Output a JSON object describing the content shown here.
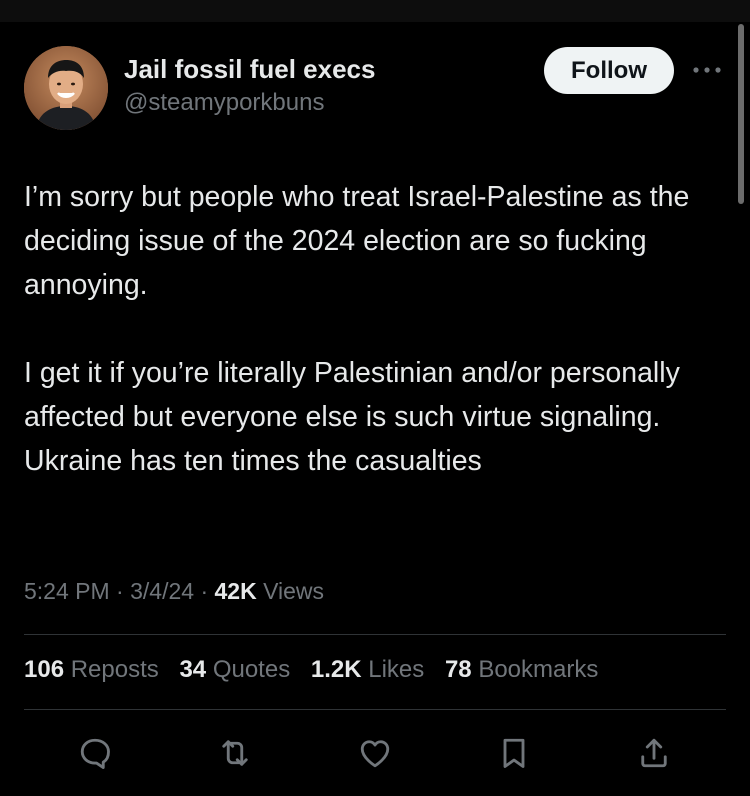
{
  "author": {
    "display_name": "Jail fossil fuel execs",
    "handle": "@steamyporkbuns"
  },
  "header": {
    "follow_label": "Follow",
    "more_icon": "more-horizontal-icon"
  },
  "tweet": {
    "paragraphs": [
      "I’m sorry but people who treat Israel-Palestine as the deciding issue of the 2024 election are so fucking annoying.",
      "I get it if you’re literally Palestinian and/or personally affected but everyone else is such virtue signaling. Ukraine has ten times the casualties"
    ]
  },
  "meta": {
    "time": "5:24 PM",
    "separator": "·",
    "date": "3/4/24",
    "views_count": "42K",
    "views_label": "Views"
  },
  "stats": {
    "reposts_count": "106",
    "reposts_label": "Reposts",
    "quotes_count": "34",
    "quotes_label": "Quotes",
    "likes_count": "1.2K",
    "likes_label": "Likes",
    "bookmarks_count": "78",
    "bookmarks_label": "Bookmarks"
  },
  "actions": {
    "reply_icon": "reply-icon",
    "repost_icon": "repost-icon",
    "like_icon": "heart-icon",
    "bookmark_icon": "bookmark-icon",
    "share_icon": "share-icon"
  },
  "colors": {
    "background": "#000000",
    "text_primary": "#e7e9ea",
    "text_secondary": "#71767b",
    "divider": "#2f3336",
    "follow_bg": "#eff3f4",
    "follow_text": "#0f1419",
    "icon": "#71767b"
  }
}
